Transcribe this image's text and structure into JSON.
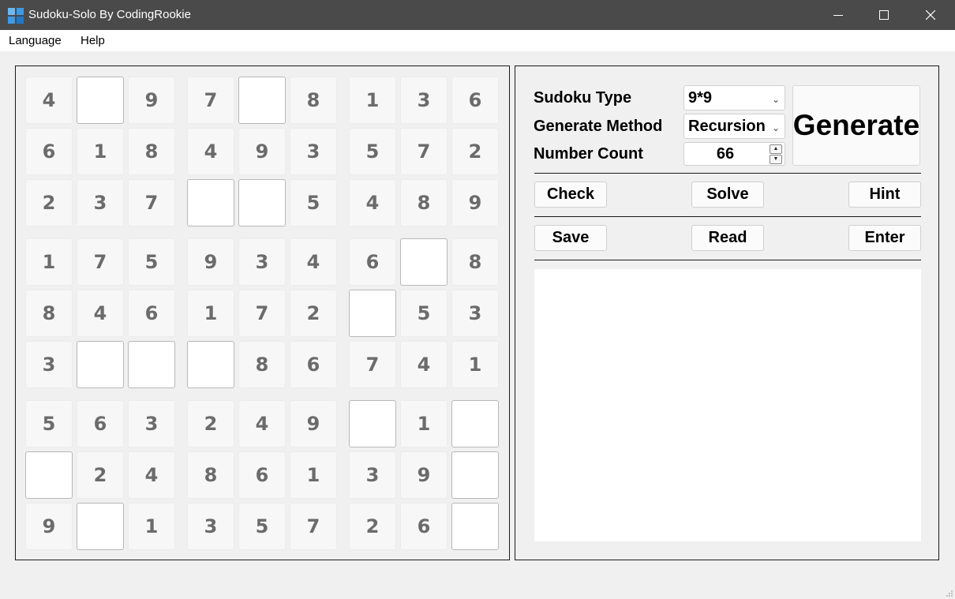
{
  "window": {
    "title": "Sudoku-Solo By CodingRookie"
  },
  "menu": {
    "language": "Language",
    "help": "Help"
  },
  "board": [
    [
      "4",
      "",
      "9",
      "7",
      "",
      "8",
      "1",
      "3",
      "6"
    ],
    [
      "6",
      "1",
      "8",
      "4",
      "9",
      "3",
      "5",
      "7",
      "2"
    ],
    [
      "2",
      "3",
      "7",
      "",
      "",
      "5",
      "4",
      "8",
      "9"
    ],
    [
      "1",
      "7",
      "5",
      "9",
      "3",
      "4",
      "6",
      "",
      "8"
    ],
    [
      "8",
      "4",
      "6",
      "1",
      "7",
      "2",
      "",
      "5",
      "3"
    ],
    [
      "3",
      "",
      "",
      "",
      "8",
      "6",
      "7",
      "4",
      "1"
    ],
    [
      "5",
      "6",
      "3",
      "2",
      "4",
      "9",
      "",
      "1",
      ""
    ],
    [
      "",
      "2",
      "4",
      "8",
      "6",
      "1",
      "3",
      "9",
      ""
    ],
    [
      "9",
      "",
      "1",
      "3",
      "5",
      "7",
      "2",
      "6",
      ""
    ]
  ],
  "controls": {
    "sudoku_type_label": "Sudoku Type",
    "sudoku_type_value": "9*9",
    "generate_method_label": "Generate Method",
    "generate_method_value": "Recursion",
    "number_count_label": "Number Count",
    "number_count_value": "66",
    "generate_label": "Generate",
    "check_label": "Check",
    "solve_label": "Solve",
    "hint_label": "Hint",
    "save_label": "Save",
    "read_label": "Read",
    "enter_label": "Enter"
  },
  "colors": {
    "titlebar": "#4a4a4a",
    "given_text": "#6b6b6b",
    "icon_blue": "#3c9be8"
  }
}
